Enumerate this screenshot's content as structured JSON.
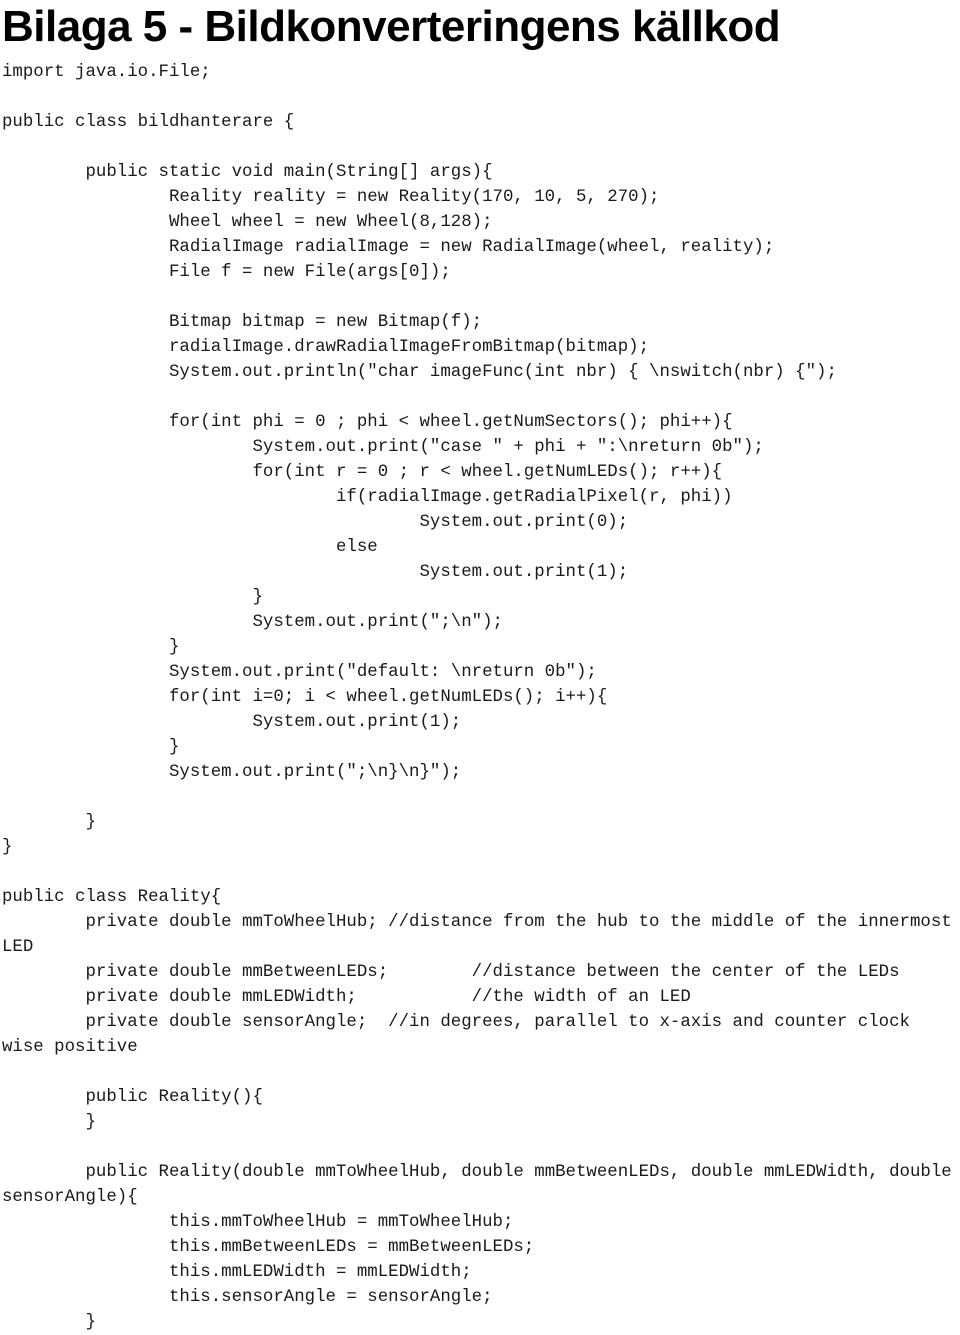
{
  "document": {
    "title": "Bilaga 5 - Bildkonverteringens källkod",
    "language": "sv",
    "code_language": "java",
    "code_lines": [
      "import java.io.File;",
      "",
      "public class bildhanterare {",
      "",
      "        public static void main(String[] args){",
      "                Reality reality = new Reality(170, 10, 5, 270);",
      "                Wheel wheel = new Wheel(8,128);",
      "                RadialImage radialImage = new RadialImage(wheel, reality);",
      "                File f = new File(args[0]);",
      "",
      "                Bitmap bitmap = new Bitmap(f);",
      "                radialImage.drawRadialImageFromBitmap(bitmap);",
      "                System.out.println(\"char imageFunc(int nbr) { \\nswitch(nbr) {\");",
      "",
      "                for(int phi = 0 ; phi < wheel.getNumSectors(); phi++){",
      "                        System.out.print(\"case \" + phi + \":\\nreturn 0b\");",
      "                        for(int r = 0 ; r < wheel.getNumLEDs(); r++){",
      "                                if(radialImage.getRadialPixel(r, phi))",
      "                                        System.out.print(0);",
      "                                else",
      "                                        System.out.print(1);",
      "                        }",
      "                        System.out.print(\";\\n\");",
      "                }",
      "                System.out.print(\"default: \\nreturn 0b\");",
      "                for(int i=0; i < wheel.getNumLEDs(); i++){",
      "                        System.out.print(1);",
      "                }",
      "                System.out.print(\";\\n}\\n}\");",
      "",
      "        }",
      "}",
      "",
      "public class Reality{",
      "        private double mmToWheelHub; //distance from the hub to the middle of the innermost LED",
      "        private double mmBetweenLEDs;        //distance between the center of the LEDs",
      "        private double mmLEDWidth;           //the width of an LED",
      "        private double sensorAngle;  //in degrees, parallel to x-axis and counter clock wise positive",
      "",
      "        public Reality(){",
      "        }",
      "",
      "        public Reality(double mmToWheelHub, double mmBetweenLEDs, double mmLEDWidth, double sensorAngle){",
      "                this.mmToWheelHub = mmToWheelHub;",
      "                this.mmBetweenLEDs = mmBetweenLEDs;",
      "                this.mmLEDWidth = mmLEDWidth;",
      "                this.sensorAngle = sensorAngle;",
      "        }"
    ]
  }
}
